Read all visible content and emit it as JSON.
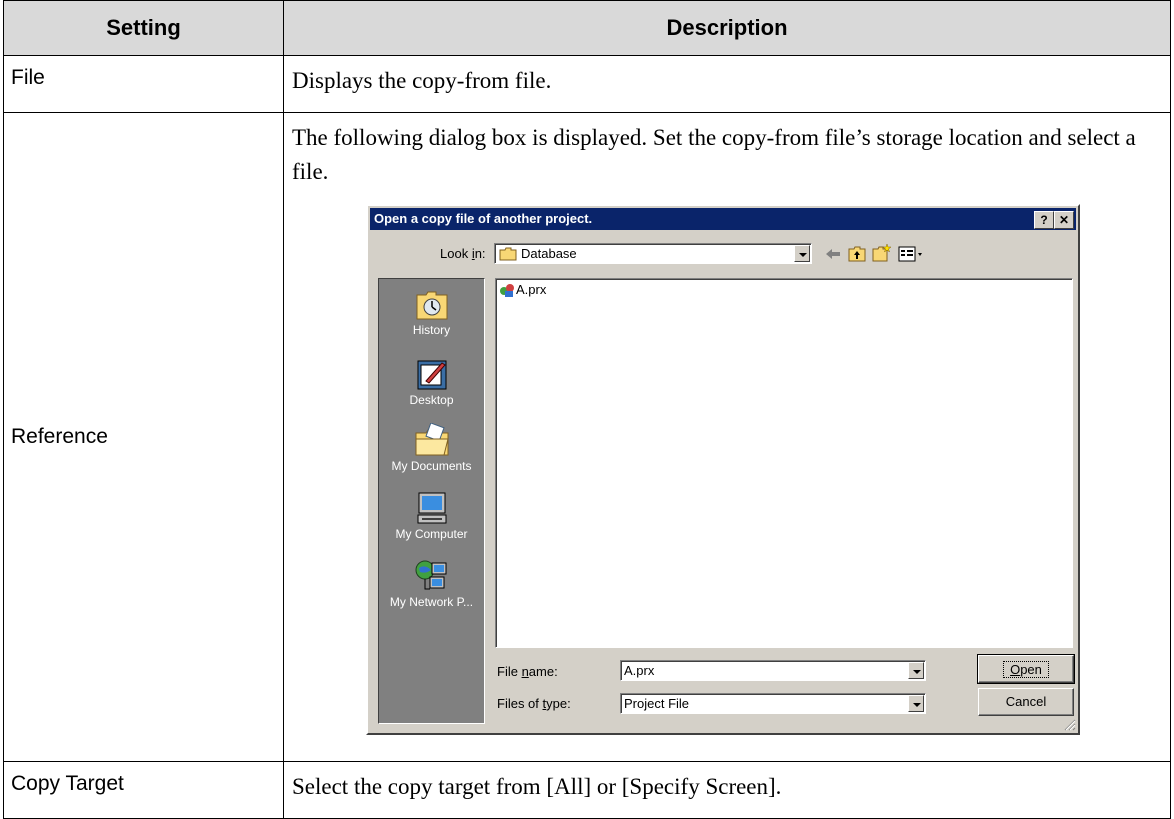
{
  "table": {
    "headers": {
      "setting": "Setting",
      "description": "Description"
    },
    "rows": [
      {
        "setting": "File",
        "description": "Displays the copy-from file."
      },
      {
        "setting": "Reference",
        "description": "The following dialog box is displayed. Set the copy-from file’s storage location and select a file."
      },
      {
        "setting": "Copy Target",
        "description": "Select the copy target from [All] or [Specify Screen]."
      }
    ]
  },
  "dialog": {
    "title": "Open a copy file of another project.",
    "help_button": "?",
    "close_button": "✕",
    "look_in_label": "Look in:",
    "look_in_value": "Database",
    "places": [
      {
        "label": "History",
        "icon": "history-icon"
      },
      {
        "label": "Desktop",
        "icon": "desktop-icon"
      },
      {
        "label": "My Documents",
        "icon": "my-documents-icon"
      },
      {
        "label": "My Computer",
        "icon": "my-computer-icon"
      },
      {
        "label": "My Network P...",
        "icon": "my-network-places-icon"
      }
    ],
    "files": [
      {
        "name": "A.prx",
        "icon": "project-file-icon"
      }
    ],
    "file_name_label": "File name:",
    "file_name_value": "A.prx",
    "files_of_type_label": "Files of type:",
    "files_of_type_value": "Project File",
    "open_button": "Open",
    "cancel_button": "Cancel"
  }
}
